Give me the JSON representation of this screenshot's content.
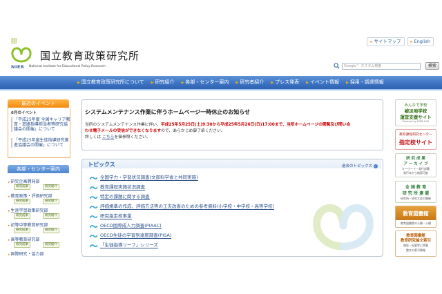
{
  "header": {
    "logo_title": "国立教育政策研究所",
    "logo_abbr": "NIER",
    "logo_english": "National Institute for Educational Policy Research",
    "top_links": [
      {
        "label": "サイトマップ"
      },
      {
        "label": "English"
      }
    ],
    "search": {
      "placeholder": "Google™ カスタム検索",
      "button_label": "検索"
    }
  },
  "nav": {
    "items": [
      {
        "label": "国立教育政策研究所について"
      },
      {
        "label": "研究紹介"
      },
      {
        "label": "各部・センター案内"
      },
      {
        "label": "研究者紹介"
      },
      {
        "label": "プレス発表"
      },
      {
        "label": "イベント情報"
      },
      {
        "label": "採用・調達情報"
      }
    ]
  },
  "events": {
    "heading": "最近のイベント",
    "month": "6月のイベント",
    "items": [
      {
        "label": "「平成25年度 全国キャリア教育・進路指導担当者等研究協議会の開催」について"
      },
      {
        "label": "「平成25年度生徒指導研究推進協議会の開催」について"
      }
    ]
  },
  "departments": {
    "heading": "各部・センター案内",
    "items": [
      {
        "label": "研究企画開発部",
        "tags": [
          "研究成果",
          "研究紹介"
        ]
      },
      {
        "label": "教育政策・評価研究部",
        "tags": [
          "研究成果",
          "研究紹介"
        ]
      },
      {
        "label": "生涯学習政策研究部",
        "tags": [
          "研究成果",
          "研究紹介"
        ]
      },
      {
        "label": "初等中等教育研究部",
        "tags": [
          "研究成果",
          "研究紹介"
        ]
      },
      {
        "label": "高等教育研究部",
        "tags": [
          "研究成果",
          "研究紹介"
        ]
      },
      {
        "label": "国際研究・協力部",
        "tags": []
      }
    ]
  },
  "notice": {
    "title": "システムメンテナンス作業に伴うホームページ一時休止のお知らせ",
    "line1_prefix": "当所のシステムメンテナンス作業に伴い、",
    "line1_red": "平成25年5月25日(土)9:30から平成25年5月26日(日)17:00まで、当所ホームページの閲覧及び問い合",
    "line2_red": "わせ電子メールの受信ができなくなります",
    "line2_suffix": "ので、あらかじめ御了承ください。",
    "line3_prefix": "詳しくは",
    "line3_link": "こちら",
    "line3_suffix": "を御参照ください。"
  },
  "topics": {
    "heading": "トピックス",
    "archive_label": "過去のトピックス",
    "items": [
      {
        "label": "全国学力・学習状況調査(文部科学省と共同実施)"
      },
      {
        "label": "教育課程実施状況調査"
      },
      {
        "label": "特定の課題に関する調査"
      },
      {
        "label": "評価規準の作成、評価方法等の工夫改善のための参考資料(小学校・中学校・高等学校)"
      },
      {
        "label": "研究指定校事業"
      },
      {
        "label": "OECD国際成人力調査(PIAAC)"
      },
      {
        "label": "OECD生徒の学習到達度調査(PISA)"
      },
      {
        "label": "「生徒指導リーフ」シリーズ"
      }
    ]
  },
  "banners": {
    "b1": {
      "line1": "みんなで学校",
      "line2": "運営支援サイト",
      "line3": "Powered by NIER & MI",
      "top": "被災地学校"
    },
    "b2": {
      "line1": "教育課程研究センター",
      "line2": "指定校サイト"
    },
    "b3": {
      "line1": "研 究 成 果",
      "line2": "ア ー カ イ ブ",
      "line3": "キーワード・発行部署",
      "line4": "発行年から検索可能"
    },
    "b4": {
      "line1": "全 国 教 育",
      "line2": "研 究 所 連 盟",
      "line3": "研究所・研究大会の開催"
    },
    "b5": {
      "line1": "教育図書館",
      "line2": "教育図書館の公開・公開"
    },
    "b6": {
      "line1": "教育図書館",
      "line2": "教育研究論文索引",
      "line3": "雑誌・紀要等に掲載",
      "line4": "論文の索引情報"
    }
  },
  "colors": {
    "nav_blue": "#3d74c4",
    "accent_orange": "#f48a10",
    "link_blue": "#2a4f8a",
    "notice_red": "#d00000",
    "logo_green": "#9cbf3a"
  }
}
